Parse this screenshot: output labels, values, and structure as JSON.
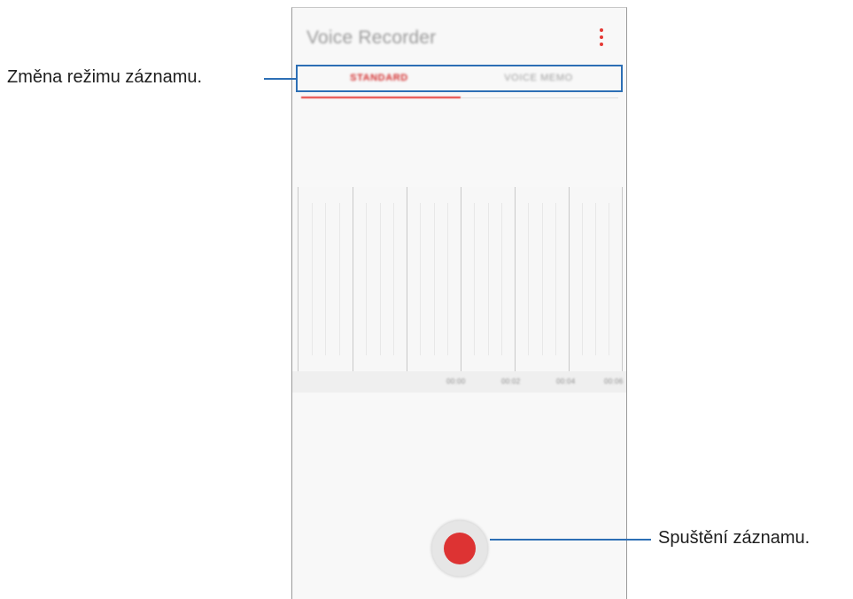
{
  "app": {
    "title": "Voice Recorder",
    "menu_icon": "more-vertical-icon"
  },
  "tabs": [
    {
      "label": "STANDARD",
      "selected": true
    },
    {
      "label": "VOICE MEMO",
      "selected": false
    }
  ],
  "timeline": {
    "ticks": [
      "00:00",
      "00:02",
      "00:04",
      "00:06"
    ]
  },
  "controls": {
    "record_icon": "record-icon"
  },
  "annotations": {
    "mode_label": "Změna režimu záznamu.",
    "record_label": "Spuštění záznamu."
  },
  "colors": {
    "accent": "#e53935",
    "callout": "#2d6fb5"
  }
}
